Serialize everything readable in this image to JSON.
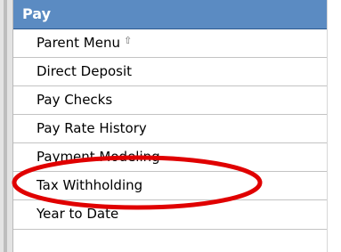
{
  "menu": {
    "title": "Pay",
    "items": [
      {
        "label": "Parent Menu",
        "icon": "up-arrow-icon"
      },
      {
        "label": "Direct Deposit"
      },
      {
        "label": "Pay Checks"
      },
      {
        "label": "Pay Rate History"
      },
      {
        "label": "Payment Modeling"
      },
      {
        "label": "Tax Withholding"
      },
      {
        "label": "Year to Date"
      }
    ]
  },
  "colors": {
    "header_bg": "#5b8bc2",
    "annotation": "#e00000"
  }
}
